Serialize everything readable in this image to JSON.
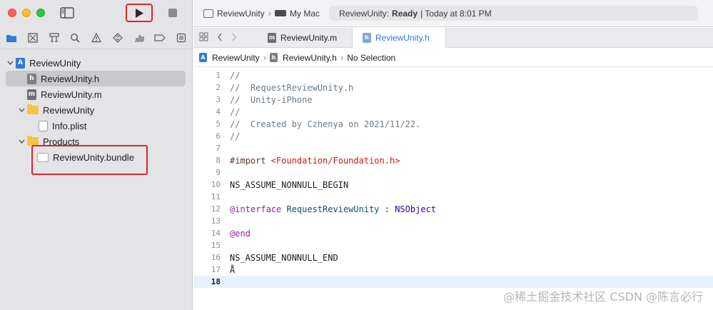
{
  "toolbar": {
    "run_label": "Run",
    "scheme_project": "ReviewUnity",
    "scheme_destination": "My Mac",
    "status_project": "ReviewUnity:",
    "status_state": "Ready",
    "status_time": "| Today at 8:01 PM"
  },
  "sidebar": {
    "items": [
      {
        "label": "ReviewUnity",
        "type": "project"
      },
      {
        "label": "ReviewUnity.h",
        "type": "header",
        "badge": "h"
      },
      {
        "label": "ReviewUnity.m",
        "type": "source",
        "badge": "m"
      },
      {
        "label": "ReviewUnity",
        "type": "folder"
      },
      {
        "label": "Info.plist",
        "type": "plist"
      },
      {
        "label": "Products",
        "type": "folder"
      },
      {
        "label": "ReviewUnity.bundle",
        "type": "bundle"
      }
    ]
  },
  "tabs": [
    {
      "label": "ReviewUnity.m",
      "badge": "m",
      "active": false
    },
    {
      "label": "ReviewUnity.h",
      "badge": "h",
      "active": true
    }
  ],
  "jumpbar": {
    "project": "ReviewUnity",
    "file": "ReviewUnity.h",
    "selection": "No Selection"
  },
  "editor": {
    "current_line": 18,
    "lines": [
      {
        "n": "1",
        "text": "//"
      },
      {
        "n": "2",
        "text": "//  RequestReviewUnity.h"
      },
      {
        "n": "3",
        "text": "//  Unity-iPhone"
      },
      {
        "n": "4",
        "text": "//"
      },
      {
        "n": "5",
        "text": "//  Created by Czhenya on 2021/11/22."
      },
      {
        "n": "6",
        "text": "//"
      },
      {
        "n": "7",
        "text": ""
      },
      {
        "n": "8",
        "text": "#import ",
        "extra": "<Foundation/Foundation.h>"
      },
      {
        "n": "9",
        "text": ""
      },
      {
        "n": "10",
        "text": "NS_ASSUME_NONNULL_BEGIN"
      },
      {
        "n": "11",
        "text": ""
      },
      {
        "n": "12",
        "text": "@interface",
        "extra": " RequestReviewUnity ",
        "extra2": ": ",
        "extra3": "NSObject"
      },
      {
        "n": "13",
        "text": ""
      },
      {
        "n": "14",
        "text": "@end"
      },
      {
        "n": "15",
        "text": ""
      },
      {
        "n": "16",
        "text": "NS_ASSUME_NONNULL_END"
      },
      {
        "n": "17",
        "text": "Å"
      },
      {
        "n": "18",
        "text": ""
      }
    ]
  },
  "watermark": "@稀土掘金技术社区 CSDN @陈言必行"
}
